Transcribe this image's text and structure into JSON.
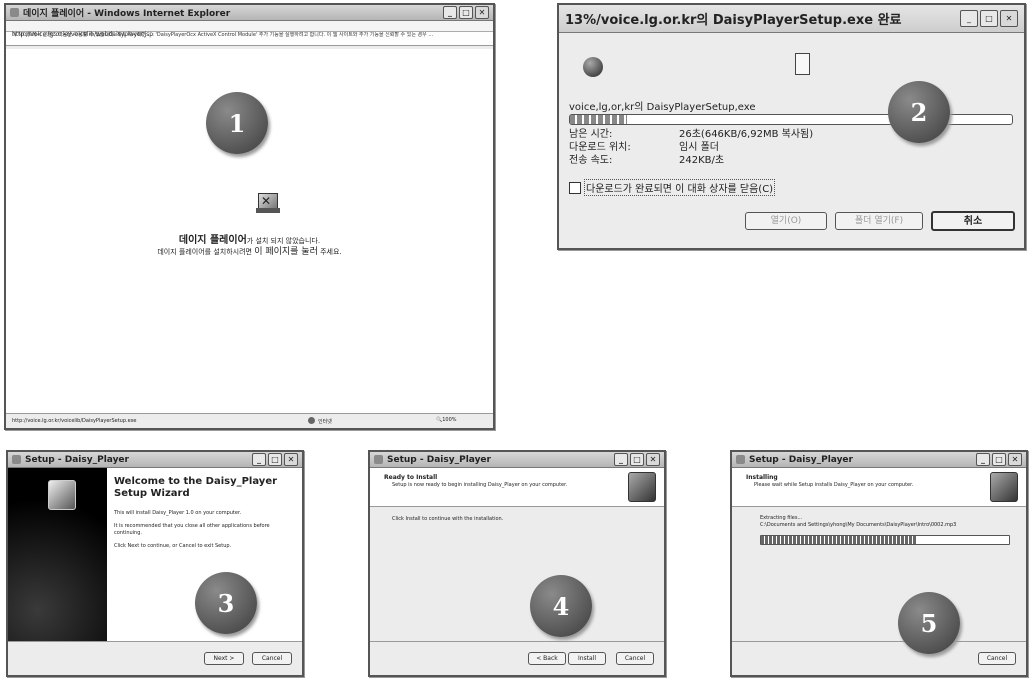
{
  "panels": {
    "p1": {
      "title": "데이지 플레이어 - Windows Internet Explorer",
      "address": "http://voice.lg.or.kr/voicelib/webdaisyplayer.jsp",
      "infobar": "이 사이트에서 콘텐츠 다음을 사용할 수 있습니다. 계속 하시려면 ...: 'DaisyPlayerOcx ActiveX Control Module' 추가 기능을 실행하려고 합니다. 이 웹 사이트와 추가 기능을 신뢰할 수 있는 경우 ...",
      "message_bold": "데이지 플레이어",
      "message_rest": "가 설치 되지 않았습니다.",
      "message_line2_a": "데이지 플레이어를 설치하시려면 ",
      "message_line2_b": "이 페이지를 눌러",
      "message_line2_c": " 주세요.",
      "status_url": "http://voice.lg.or.kr/voicelib/DaisyPlayerSetup.exe",
      "status_zone": "인터넷",
      "status_zoom": "100%",
      "badge": "1"
    },
    "p2": {
      "title": "13%/voice.lg.or.kr의 DaisyPlayerSetup.exe 완료",
      "filename": "voice,lg,or,kr의 DaisyPlayerSetup,exe",
      "progress": 13,
      "rows": [
        {
          "label": "남은 시간:",
          "value": "26초(646KB/6,92MB 복사됨)"
        },
        {
          "label": "다운로드 위치:",
          "value": "임시 폴더"
        },
        {
          "label": "전송 속도:",
          "value": "242KB/초"
        }
      ],
      "checkbox": "다운로드가 완료되면 이 대화 상자를 닫음(C)",
      "btn_open": "열기(O)",
      "btn_folder": "폴더 열기(F)",
      "btn_cancel": "취소",
      "badge": "2"
    },
    "p3": {
      "title": "Setup - Daisy_Player",
      "heading": "Welcome to the Daisy_Player Setup Wizard",
      "line1": "This will install Daisy_Player 1.0 on your computer.",
      "line2": "It is recommended that you close all other applications before continuing.",
      "line3": "Click Next to continue, or Cancel to exit Setup.",
      "btn_next": "Next >",
      "btn_cancel": "Cancel",
      "badge": "3"
    },
    "p4": {
      "title": "Setup - Daisy_Player",
      "head": "Ready to Install",
      "sub": "Setup is now ready to begin installing Daisy_Player on your computer.",
      "body": "Click Install to continue with the installation.",
      "btn_back": "< Back",
      "btn_install": "Install",
      "btn_cancel": "Cancel",
      "badge": "4"
    },
    "p5": {
      "title": "Setup - Daisy_Player",
      "head": "Installing",
      "sub": "Please wait while Setup installs Daisy_Player on your computer.",
      "extract": "Extracting files...",
      "path": "C:\\Documents and Settings\\yhong\\My Documents\\DaisyPlayer\\Intro\\0002.mp3",
      "progress": 63,
      "btn_cancel": "Cancel",
      "badge": "5"
    }
  }
}
